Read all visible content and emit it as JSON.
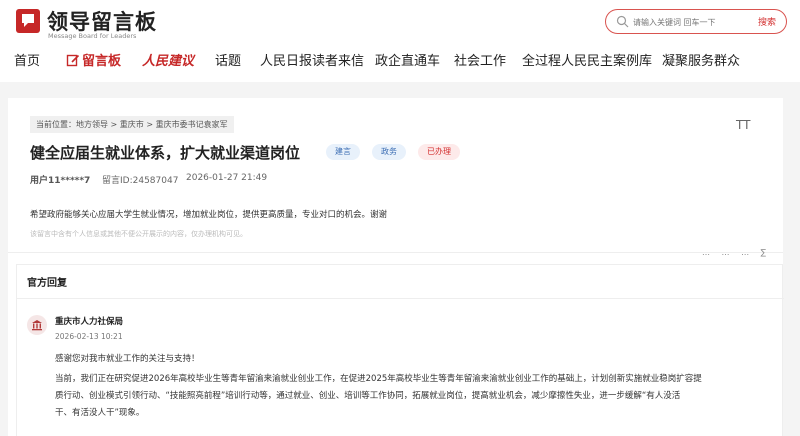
{
  "brand": {
    "title": "领导留言板",
    "subtitle": "Message Board for Leaders"
  },
  "search": {
    "placeholder": "请输入关键词 回车一下",
    "button": "搜索"
  },
  "nav": [
    {
      "label": "首页"
    },
    {
      "label": "留言板"
    },
    {
      "label": "人民建议"
    },
    {
      "label": "话题"
    },
    {
      "label": "人民日报读者来信"
    },
    {
      "label": "政企直通车"
    },
    {
      "label": "社会工作"
    },
    {
      "label": "全过程人民民主案例库"
    },
    {
      "label": "凝聚服务群众"
    }
  ],
  "breadcrumb": {
    "prefix": "当前位置：",
    "items": [
      "地方领导",
      "重庆市",
      "重庆市委书记袁家军"
    ],
    "sep": ">"
  },
  "font_toggle": "TT",
  "post": {
    "title": "健全应届生就业体系，扩大就业渠道岗位",
    "tags": [
      "建言",
      "政务",
      "已办理"
    ],
    "user": "用户11*****7",
    "id_label": "留言ID:24587047",
    "datetime": "2026-01-27 21:49",
    "body": "希望政府能够关心应届大学生就业情况，增加就业岗位，提供更高质量，专业对口的机会。谢谢",
    "note": "该留言中含有个人信息或其他不便公开展示的内容，仅办理机构可见。"
  },
  "actions": [
    "…",
    "…",
    "…",
    "∑"
  ],
  "reply": {
    "heading": "官方回复",
    "org": "重庆市人力社保局",
    "time": "2026-02-13 10:21",
    "lines": [
      "感谢您对我市就业工作的关注与支持！",
      "当前，我们正在研究促进2026年高校毕业生等青年留渝来渝就业创业工作，在促进2025年高校毕业生等青年留渝来渝就业创业工作的基础上，计划创新实施就业稳岗扩容提",
      "质行动、创业模式引领行动、“技能照亮前程”培训行动等，通过就业、创业、培训等工作协同，拓展就业岗位，提高就业机会，减少摩擦性失业，进一步缓解“有人没活",
      "干、有活没人干”现象。"
    ]
  },
  "colors": {
    "brand_red": "#c62828",
    "tag_blue_bg": "#e8f1fb",
    "tag_red_bg": "#fdeaea"
  }
}
